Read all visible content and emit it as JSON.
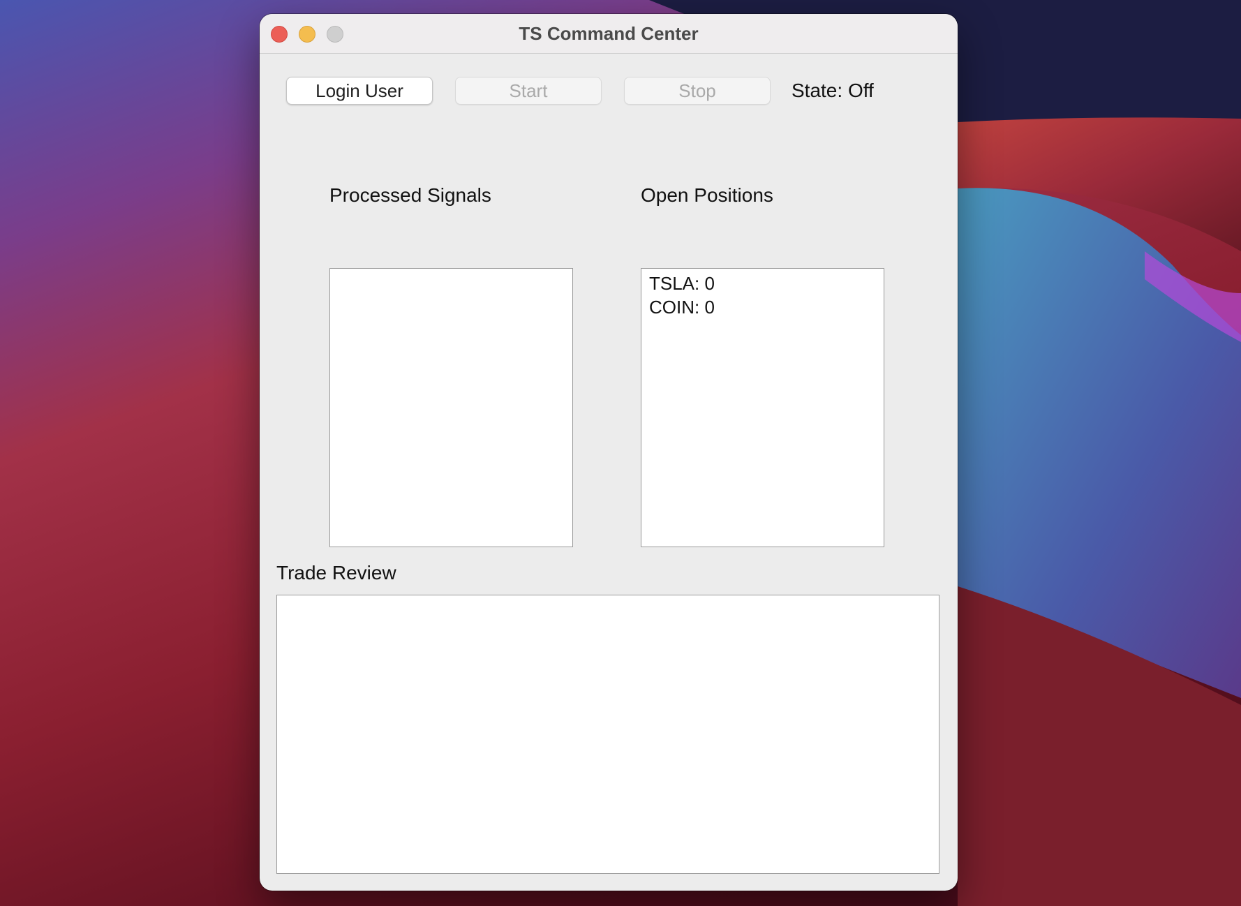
{
  "window": {
    "title": "TS Command Center"
  },
  "toolbar": {
    "login_label": "Login User",
    "start_label": "Start",
    "stop_label": "Stop",
    "state_text": "State: Off"
  },
  "processed_signals": {
    "label": "Processed Signals",
    "items": []
  },
  "open_positions": {
    "label": "Open Positions",
    "items": [
      "TSLA: 0",
      "COIN: 0"
    ]
  },
  "trade_review": {
    "label": "Trade Review",
    "text": ""
  }
}
